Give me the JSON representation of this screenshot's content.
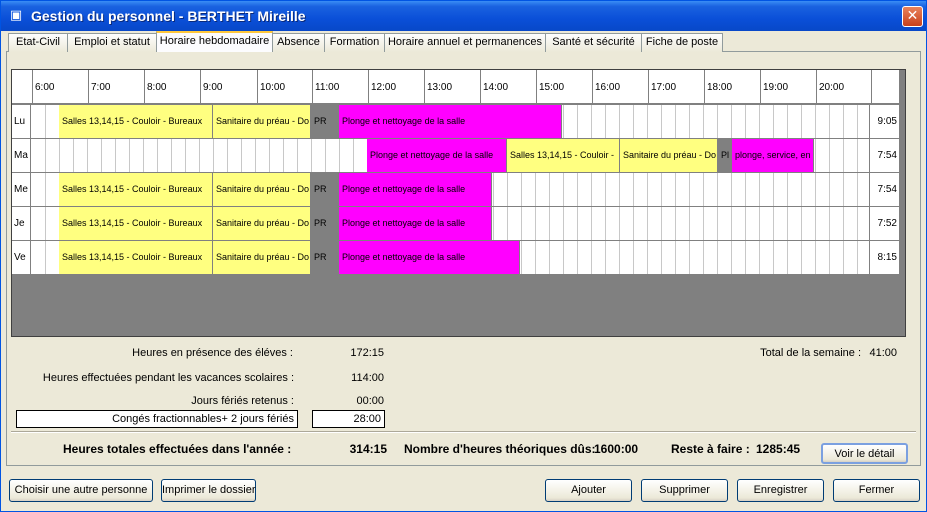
{
  "window": {
    "title": "Gestion du personnel - BERTHET Mireille",
    "icon": "app-icon",
    "close": "✕"
  },
  "tabs": [
    {
      "label": "Etat-Civil"
    },
    {
      "label": "Emploi et statut"
    },
    {
      "label": "Horaire hebdomadaire"
    },
    {
      "label": "Absence"
    },
    {
      "label": "Formation"
    },
    {
      "label": "Horaire annuel et permanences"
    },
    {
      "label": "Santé et sécurité"
    },
    {
      "label": "Fiche de poste"
    }
  ],
  "active_tab": "Horaire hebdomadaire",
  "schedule": {
    "hours": [
      "6:00",
      "7:00",
      "8:00",
      "9:00",
      "10:00",
      "11:00",
      "12:00",
      "13:00",
      "14:00",
      "15:00",
      "16:00",
      "17:00",
      "18:00",
      "19:00",
      "20:00"
    ],
    "days": [
      {
        "label": "Lu",
        "total": "9:05",
        "blocks": [
          {
            "text": "Salles 13,14,15 - Couloir - Bureaux",
            "color": "yellow"
          },
          {
            "text": "Sanitaire du préau - Do",
            "color": "yellow"
          },
          {
            "text": "PR",
            "color": "gray"
          },
          {
            "text": "Plonge et nettoyage de la salle",
            "color": "magenta"
          }
        ]
      },
      {
        "label": "Ma",
        "total": "7:54",
        "blocks": [
          {
            "text": "Plonge et nettoyage de la salle",
            "color": "magenta"
          },
          {
            "text": "Salles 13,14,15 - Couloir -",
            "color": "yellow"
          },
          {
            "text": "Sanitaire du préau - Do",
            "color": "yellow"
          },
          {
            "text": "Pl",
            "color": "gray"
          },
          {
            "text": "plonge, service, en",
            "color": "magenta"
          }
        ]
      },
      {
        "label": "Me",
        "total": "7:54",
        "blocks": [
          {
            "text": "Salles 13,14,15 - Couloir - Bureaux",
            "color": "yellow"
          },
          {
            "text": "Sanitaire du préau - Do",
            "color": "yellow"
          },
          {
            "text": "PR",
            "color": "gray"
          },
          {
            "text": "Plonge et nettoyage de la salle",
            "color": "magenta"
          }
        ]
      },
      {
        "label": "Je",
        "total": "7:52",
        "blocks": [
          {
            "text": "Salles 13,14,15 - Couloir - Bureaux",
            "color": "yellow"
          },
          {
            "text": "Sanitaire du préau - Do",
            "color": "yellow"
          },
          {
            "text": "PR",
            "color": "gray"
          },
          {
            "text": "Plonge et nettoyage de la salle",
            "color": "magenta"
          }
        ]
      },
      {
        "label": "Ve",
        "total": "8:15",
        "blocks": [
          {
            "text": "Salles 13,14,15 - Couloir - Bureaux",
            "color": "yellow"
          },
          {
            "text": "Sanitaire du préau - Do",
            "color": "yellow"
          },
          {
            "text": "PR",
            "color": "gray"
          },
          {
            "text": "Plonge et nettoyage de la salle",
            "color": "magenta"
          }
        ]
      }
    ],
    "colors": {
      "yellow": "#ffff80",
      "magenta": "#ff00ff",
      "gray": "#808080"
    }
  },
  "summary": {
    "presence_label": "Heures en présence des éléves :",
    "presence_value": "172:15",
    "vacances_label": "Heures effectuées pendant les vacances scolaires :",
    "vacances_value": "114:00",
    "feries_label": "Jours fériés retenus :",
    "feries_value": "00:00",
    "conges_label": "Congés fractionnables+ 2 jours fériés",
    "conges_value": "28:00",
    "week_total_label": "Total de la semaine :",
    "week_total_value": "41:00",
    "totales_label": "Heures totales effectuées dans l'année :",
    "totales_value": "314:15",
    "theoriques_label": "Nombre d'heures théoriques dûs:",
    "theoriques_value": "1600:00",
    "reste_label": "Reste à faire :",
    "reste_value": "1285:45"
  },
  "buttons": {
    "detail": "Voir le détail",
    "other_person": "Choisir une autre personne",
    "print": "Imprimer le dossier",
    "add": "Ajouter",
    "delete": "Supprimer",
    "save": "Enregistrer",
    "close": "Fermer"
  }
}
